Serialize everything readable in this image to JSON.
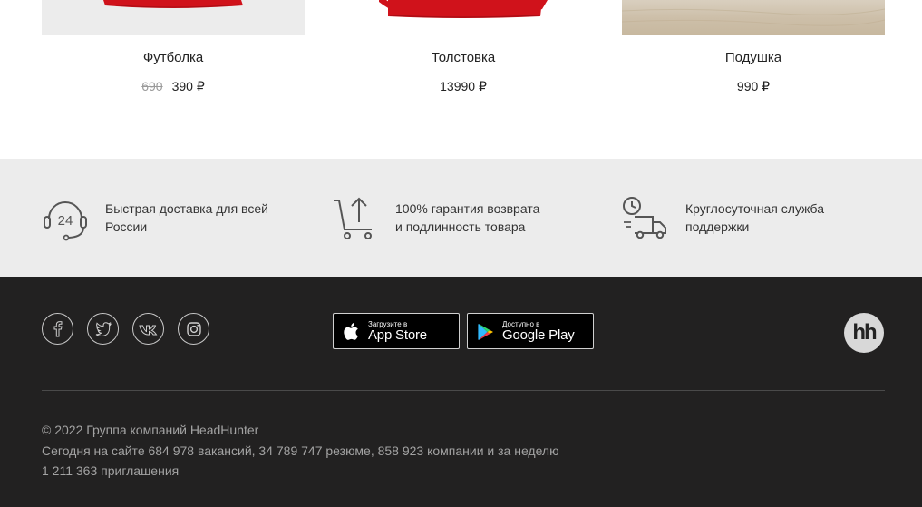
{
  "products": [
    {
      "name": "Футболка",
      "old_price": "690",
      "price": "390 ₽"
    },
    {
      "name": "Толстовка",
      "price": "13990 ₽"
    },
    {
      "name": "Подушка",
      "price": "990 ₽"
    }
  ],
  "features": [
    {
      "icon": "support-24-icon",
      "line1": "Быстрая доставка для всей",
      "line2": "России"
    },
    {
      "icon": "cart-return-icon",
      "line1": "100% гарантия возврата",
      "line2": "и подлинность товара"
    },
    {
      "icon": "delivery-truck-clock-icon",
      "line1": "Круглосуточная служба",
      "line2": "поддержки"
    }
  ],
  "footer": {
    "social": [
      "facebook-icon",
      "twitter-icon",
      "vk-icon",
      "instagram-icon"
    ],
    "appstore": {
      "small": "Загрузите в",
      "big": "App Store"
    },
    "googleplay": {
      "small": "Доступно в",
      "big": "Google Play"
    },
    "hh_logo": "hh",
    "copyright": "© 2022 Группа компаний HeadHunter",
    "stats_line1": "Сегодня на сайте 684 978 вакансий, 34 789 747 резюме, 858 923 компании и за неделю",
    "stats_line2": "1 211 363 приглашения"
  },
  "colors": {
    "footer_bg": "#222121",
    "features_bg": "#ececec",
    "product_red": "#d0021b"
  }
}
